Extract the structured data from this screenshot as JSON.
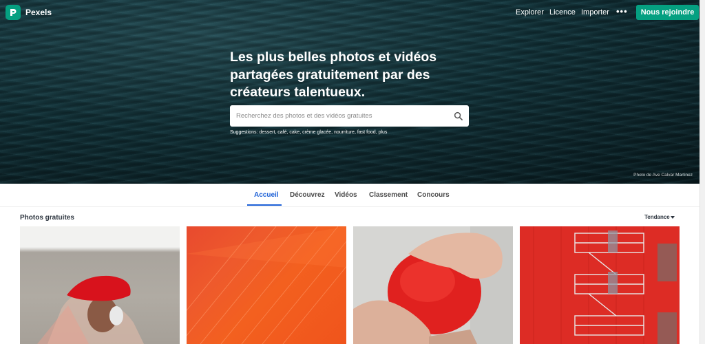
{
  "brand": {
    "name": "Pexels",
    "accent": "#05a081"
  },
  "nav": {
    "links": [
      "Explorer",
      "Licence",
      "Importer"
    ],
    "more_label": "•••",
    "join_label": "Nous rejoindre"
  },
  "hero": {
    "headline": "Les plus belles photos et vidéos partagées gratuitement par des créateurs talentueux.",
    "search_placeholder": "Recherchez des photos et des vidéos gratuites",
    "suggestions_label": "Suggestions:",
    "suggestions": "dessert, café, cake, crème glacée, nourriture, fast food, plus",
    "credit": "Photo de Ave Calvar Martinez"
  },
  "tabs": [
    "Accueil",
    "Découvrez",
    "Vidéos",
    "Classement",
    "Concours"
  ],
  "active_tab": "Accueil",
  "gallery": {
    "title": "Photos gratuites",
    "sort_label": "Tendance"
  }
}
